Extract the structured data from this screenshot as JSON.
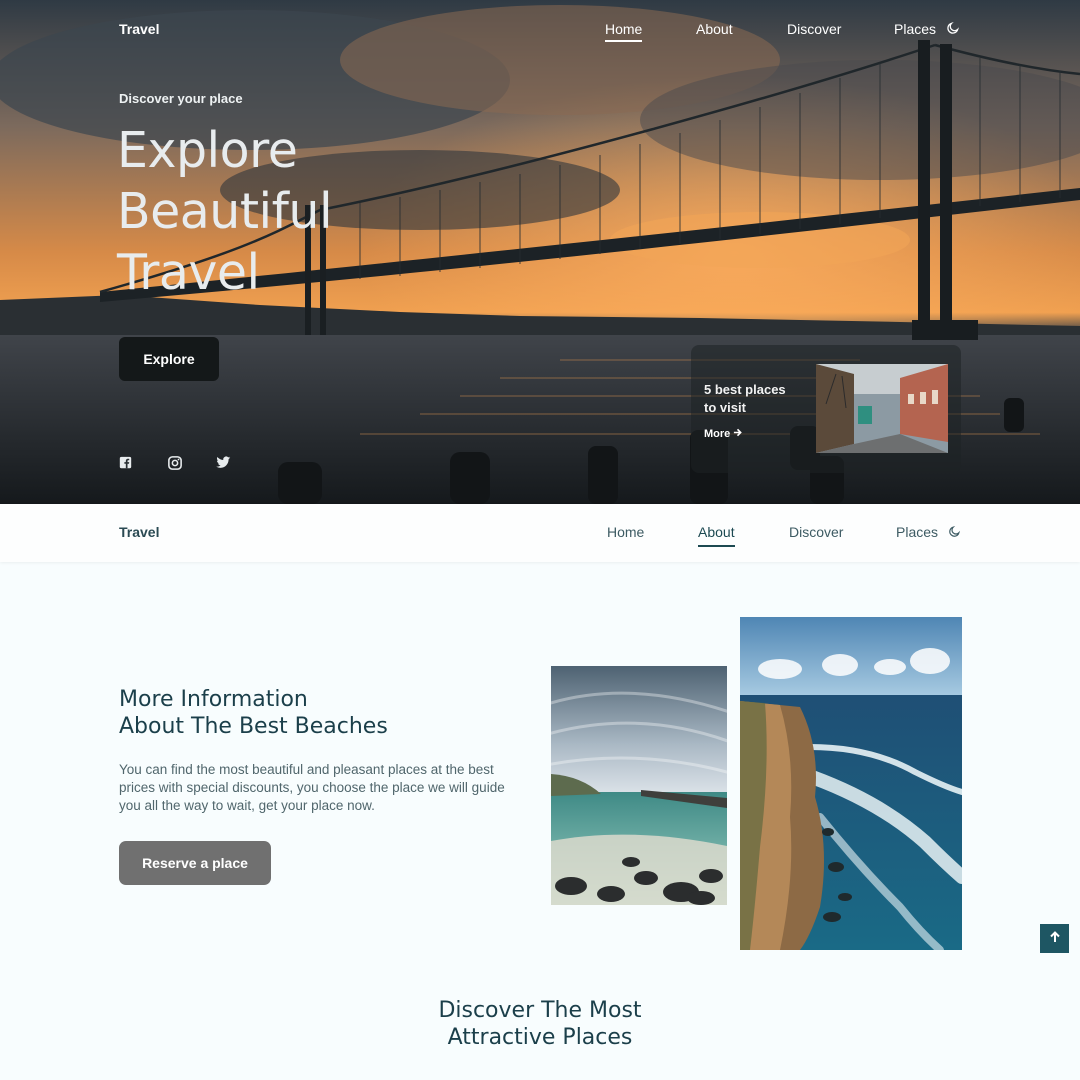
{
  "hero": {
    "brand": "Travel",
    "nav": [
      {
        "label": "Home",
        "active": true
      },
      {
        "label": "About",
        "active": false
      },
      {
        "label": "Discover",
        "active": false
      },
      {
        "label": "Places",
        "active": false
      }
    ],
    "theme_toggle_icon": "moon-icon",
    "subtitle": "Discover your place",
    "title_lines": [
      "Explore",
      "Beautiful",
      "Travel"
    ],
    "cta_label": "Explore",
    "social_icons": [
      "facebook-icon",
      "instagram-icon",
      "twitter-icon"
    ],
    "card": {
      "text_line1": "5 best places",
      "text_line2": "to visit",
      "more_label": "More",
      "more_icon": "arrow-right-icon"
    }
  },
  "header": {
    "brand": "Travel",
    "nav": [
      {
        "label": "Home",
        "active": false
      },
      {
        "label": "About",
        "active": true
      },
      {
        "label": "Discover",
        "active": false
      },
      {
        "label": "Places",
        "active": false
      }
    ],
    "theme_toggle_icon": "moon-icon"
  },
  "about": {
    "title_line1": "More Information",
    "title_line2": "About The Best Beaches",
    "description": "You can find the most beautiful and pleasant places at the best prices with special discounts, you choose the place we will guide you all the way to wait, get your place now.",
    "button_label": "Reserve a place"
  },
  "discover": {
    "title_line1": "Discover The Most",
    "title_line2": "Attractive Places"
  },
  "scroll_top_icon": "arrow-up-icon",
  "colors": {
    "accent": "#1e5663",
    "heading": "#1b3f4a",
    "body_text": "#50666c",
    "reserve_button": "#707070",
    "explore_button": "#141819"
  }
}
